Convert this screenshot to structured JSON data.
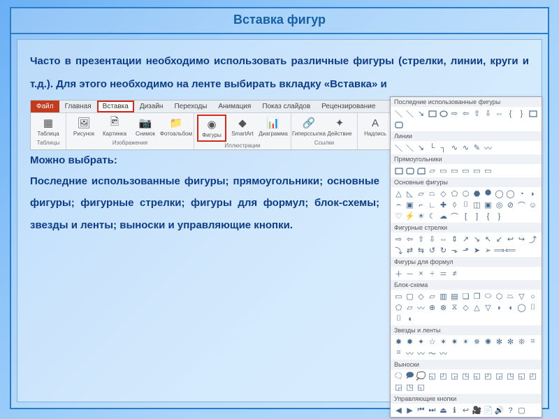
{
  "title": "Вставка фигур",
  "para1": "Часто в презентации необходимо использовать различные фигуры (стрелки, линии, круги и т.д.). Для этого необходимо на ленте выбирать вкладку «Вставка» и",
  "lead": "Можно выбрать:",
  "para2": "Последние использованные фигуры; прямоугольники; основные фигуры; фигурные стрелки; фигуры для формул; блок-схемы; звезды и ленты; выноски и управляющие кнопки.",
  "ribbon": {
    "tabs": {
      "file": "Файл",
      "home": "Главная",
      "insert": "Вставка",
      "design": "Дизайн",
      "trans": "Переходы",
      "anim": "Анимация",
      "show": "Показ слайдов",
      "review": "Рецензирование"
    },
    "groups": {
      "tables": {
        "name": "Таблицы",
        "items": {
          "table": "Таблица"
        }
      },
      "images": {
        "name": "Изображения",
        "items": {
          "pic": "Рисунок",
          "clip": "Картинка",
          "snap": "Снимок",
          "album": "Фотоальбом"
        }
      },
      "illus": {
        "name": "Иллюстрации",
        "items": {
          "shapes": "Фигуры",
          "smart": "SmartArt",
          "chart": "Диаграмма"
        }
      },
      "links": {
        "name": "Ссылки",
        "items": {
          "hyper": "Гиперссылка",
          "action": "Действие"
        }
      },
      "text": {
        "name": "",
        "items": {
          "tbox": "Надпись"
        }
      }
    }
  },
  "shape_sections": {
    "recent": "Последние использованные фигуры",
    "lines": "Линии",
    "rects": "Прямоугольники",
    "basic": "Основные фигуры",
    "arrows": "Фигурные стрелки",
    "formula": "Фигуры для формул",
    "flow": "Блок-схема",
    "stars": "Звезды и ленты",
    "callouts": "Выноски",
    "ctrl": "Управляющие кнопки"
  }
}
